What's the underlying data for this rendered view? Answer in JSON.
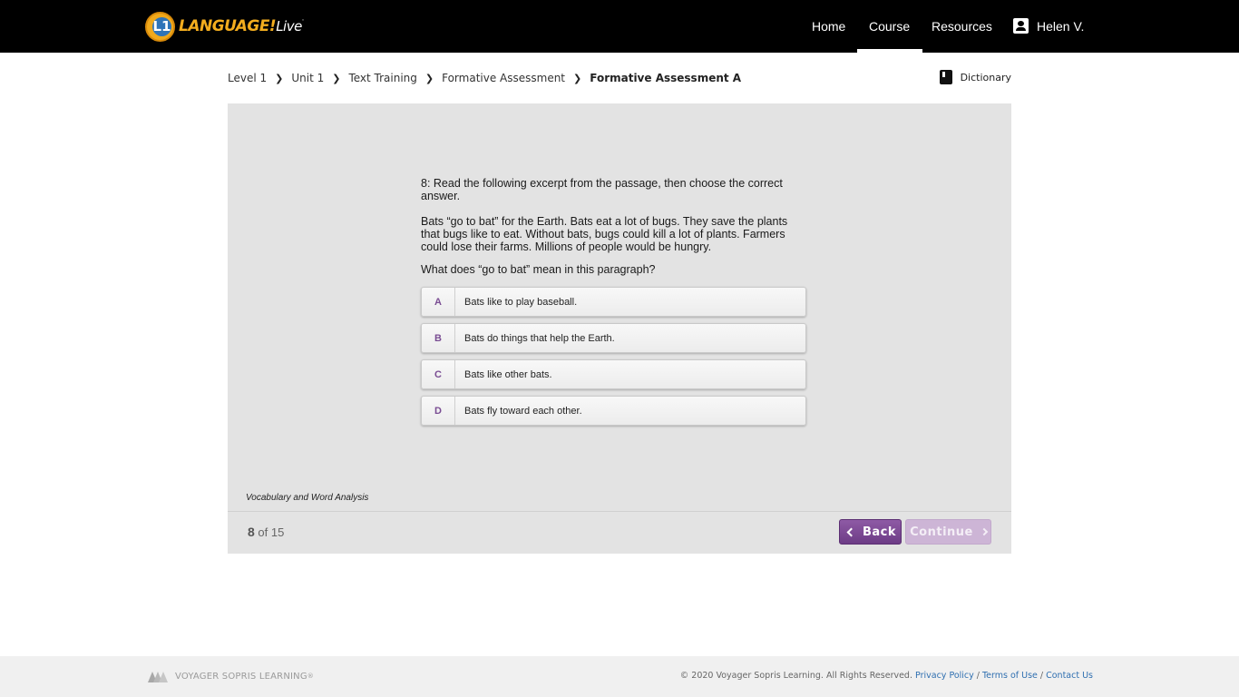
{
  "header": {
    "logo": {
      "brand": "LANGUAGE!",
      "live": "Live",
      "mark": "L1"
    },
    "nav": [
      {
        "label": "Home"
      },
      {
        "label": "Course",
        "active": true
      },
      {
        "label": "Resources"
      }
    ],
    "user": {
      "name": "Helen V.",
      "icon": "account-box-icon"
    }
  },
  "breadcrumb": {
    "items": [
      "Level 1",
      "Unit 1",
      "Text Training",
      "Formative Assessment",
      "Formative Assessment A"
    ],
    "separator": "❯"
  },
  "dictionary": {
    "label": "Dictionary",
    "icon": "book-icon"
  },
  "question": {
    "prompt": "8: Read the following excerpt from the passage, then choose the correct answer.",
    "excerpt": "Bats “go to bat” for the Earth. Bats eat a lot of bugs. They save the plants that bugs like to eat. Without bats, bugs could kill a lot of plants. Farmers could lose their farms. Millions of people would be hungry.",
    "ask": "What does “go to bat” mean in this paragraph?",
    "choices": [
      {
        "letter": "A",
        "text": "Bats like to play baseball."
      },
      {
        "letter": "B",
        "text": "Bats do things that help the Earth."
      },
      {
        "letter": "C",
        "text": "Bats like other bats."
      },
      {
        "letter": "D",
        "text": "Bats fly toward each other."
      }
    ]
  },
  "skill": "Vocabulary and Word Analysis",
  "progress": {
    "current": "8",
    "of_total": "of 15"
  },
  "buttons": {
    "back": "Back",
    "continue": "Continue"
  },
  "footer": {
    "company": "VOYAGER SOPRIS LEARNING",
    "copyright": "© 2020 Voyager Sopris Learning. All Rights Reserved.",
    "links": [
      "Privacy Policy",
      "Terms of Use",
      "Contact Us"
    ]
  },
  "colors": {
    "header_bg": "#000000",
    "accent_purple": "#7a4d93",
    "panel_bg": "#e3e3e3",
    "link_blue": "#2f6fb0",
    "logo_orange": "#f3ad1e"
  }
}
